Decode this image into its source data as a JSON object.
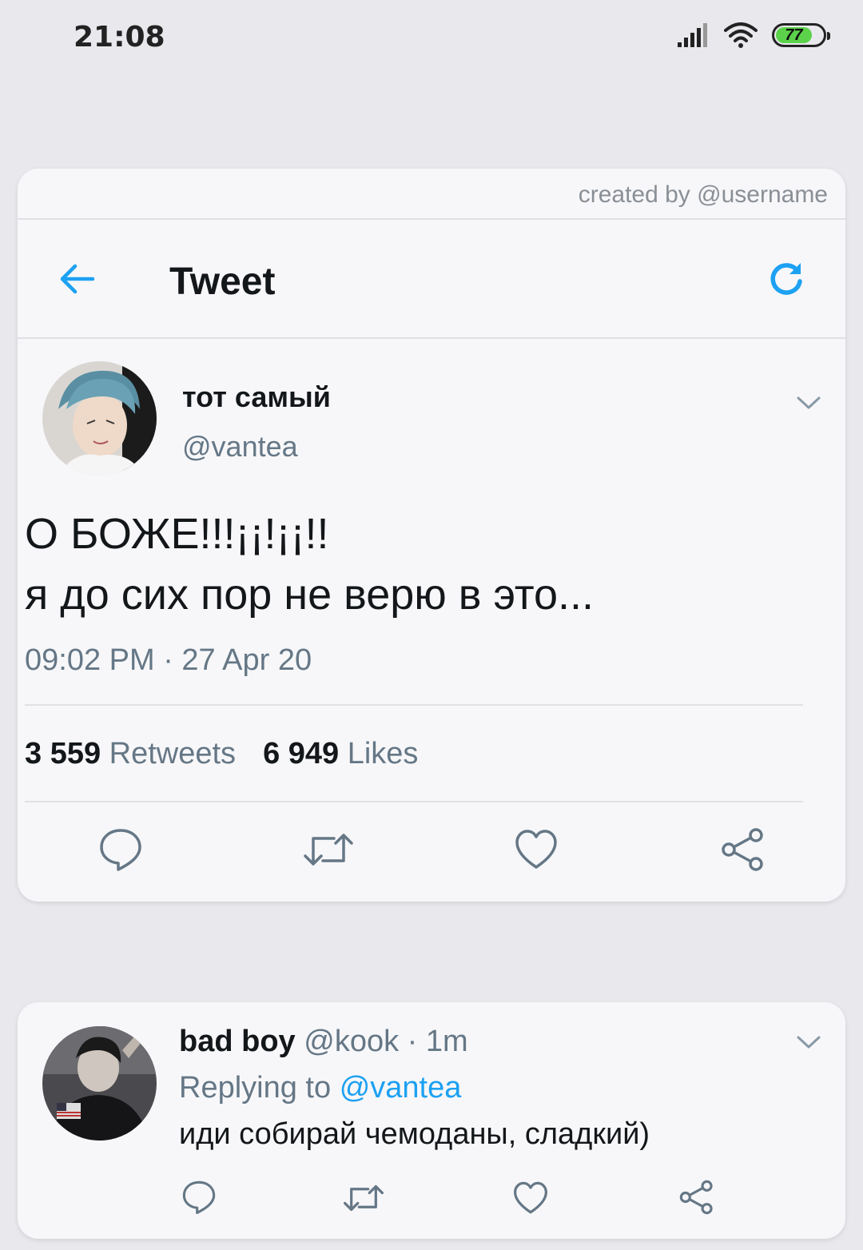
{
  "status_bar": {
    "time": "21:08",
    "battery": "77",
    "battery_level": 0.77
  },
  "main_card": {
    "credit": "created by @username",
    "header": {
      "title": "Tweet",
      "back_icon": "arrow-left-icon",
      "refresh_icon": "refresh-icon"
    },
    "author": {
      "name": "тот самый",
      "handle": "@vantea"
    },
    "tweet": {
      "line1": "О БОЖЕ!!!¡¡!¡¡!!",
      "line2": "я до сих пор не верю в это...",
      "timestamp": "09:02 PM · 27 Apr 20"
    },
    "stats": {
      "retweets_count": "3 559",
      "retweets_label": "Retweets",
      "likes_count": "6 949",
      "likes_label": "Likes"
    }
  },
  "reply_card": {
    "name": "bad boy",
    "handle": "@kook",
    "time": "· 1m",
    "replying_label": "Replying to",
    "replying_handle": "@vantea",
    "text": "иди собирай чемоданы, сладкий)"
  },
  "colors": {
    "accent": "#1da1f2",
    "background": "#e9e8ed",
    "card": "#f7f7f9",
    "muted_text": "#657786",
    "battery_green": "#5bd24a"
  }
}
